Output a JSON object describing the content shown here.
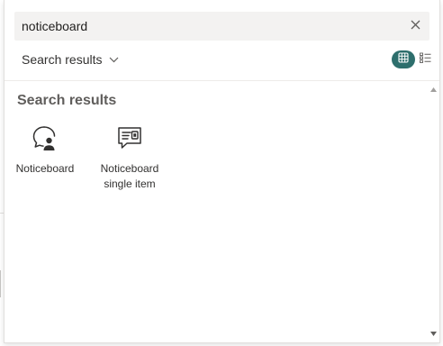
{
  "search": {
    "value": "noticeboard",
    "placeholder": "",
    "clear_icon": "close-icon"
  },
  "toolbar": {
    "filter_label": "Search results",
    "filter_icon": "chevron-down-icon",
    "view_grid_icon": "grid-view-icon",
    "view_list_icon": "list-view-icon",
    "active_view": "grid",
    "accent_color": "#2d6e6c"
  },
  "results": {
    "title": "Search results",
    "items": [
      {
        "label": "Noticeboard",
        "icon": "noticeboard-icon"
      },
      {
        "label": "Noticeboard single item",
        "icon": "noticeboard-single-item-icon"
      }
    ]
  }
}
